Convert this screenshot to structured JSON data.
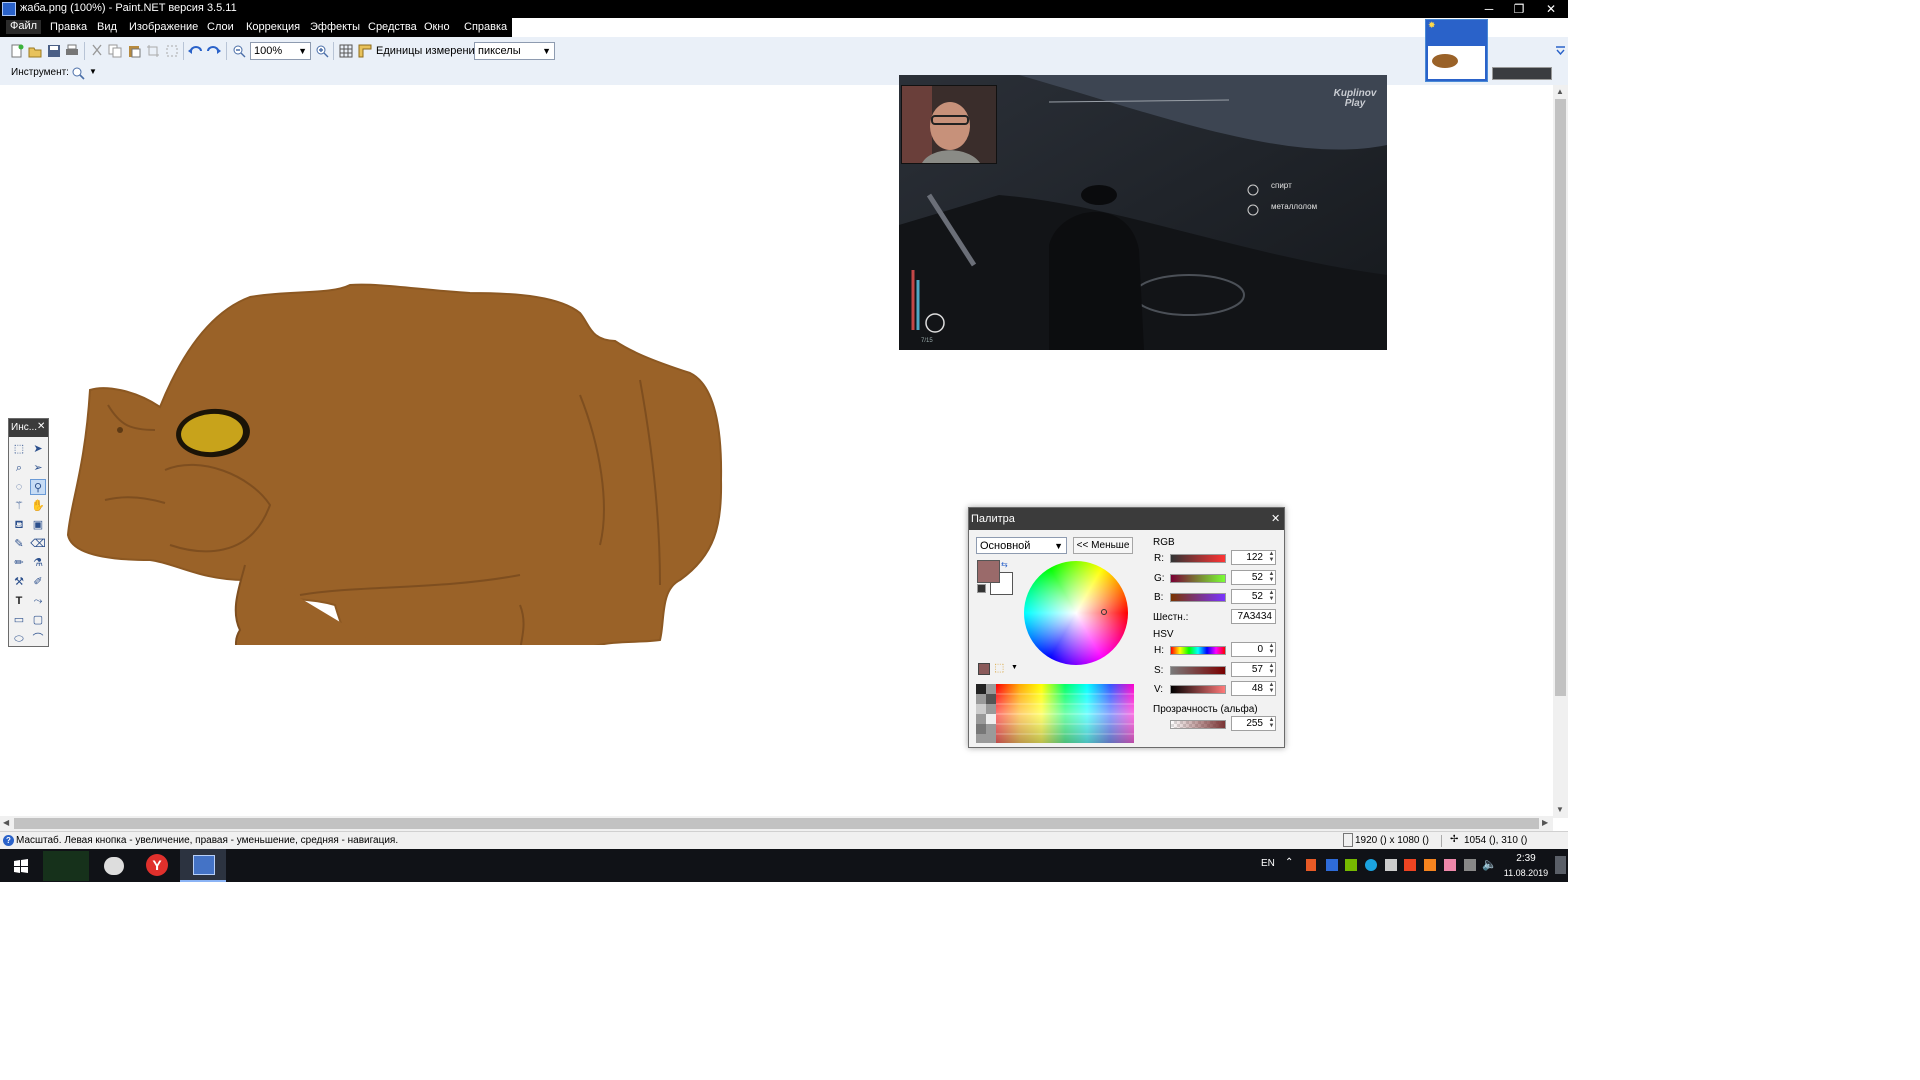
{
  "window": {
    "title": "жаба.png (100%) - Paint.NET версия 3.5.11",
    "minimize_icon": "─",
    "restore_icon": "❐",
    "close_icon": "✕"
  },
  "menu": [
    "Файл",
    "Правка",
    "Вид",
    "Изображение",
    "Слои",
    "Коррекция",
    "Эффекты",
    "Средства",
    "Окно",
    "Справка"
  ],
  "toolbar": {
    "zoom_value": "100%",
    "units_label": "Единицы измерения:",
    "units_value": "пикселы",
    "tool_label": "Инструмент:"
  },
  "stream": {
    "hud_items": [
      "спирт",
      "металлолом"
    ],
    "ammo": "7/15",
    "watermark": "Kuplinov Play"
  },
  "palette": {
    "title": "Палитра",
    "mode": "Основной",
    "less_button": "<< Меньше",
    "rgb_title": "RGB",
    "r_label": "R:",
    "r_value": "122",
    "g_label": "G:",
    "g_value": "52",
    "b_label": "B:",
    "b_value": "52",
    "hex_label": "Шестн.:",
    "hex_value": "7A3434",
    "hsv_title": "HSV",
    "h_label": "H:",
    "h_value": "0",
    "s_label": "S:",
    "s_value": "57",
    "v_label": "V:",
    "v_value": "48",
    "alpha_label": "Прозрачность (альфа)",
    "alpha_value": "255",
    "primary_color": "#7a3434",
    "secondary_color": "#ffffff"
  },
  "tools_window": {
    "title": "Инс..."
  },
  "status": {
    "hint": "Масштаб. Левая кнопка - увеличение, правая - уменьшение, средняя - навигация.",
    "image_size": "1920 () x 1080 ()",
    "cursor": "1054 (), 310 ()"
  },
  "taskbar": {
    "lang": "EN",
    "time": "2:39",
    "date": "11.08.2019"
  },
  "colors": {
    "toad": "#9a6228",
    "toad_outline": "#7e4e1f",
    "eye": "#c8a31b",
    "accent": "#2a62c9"
  }
}
